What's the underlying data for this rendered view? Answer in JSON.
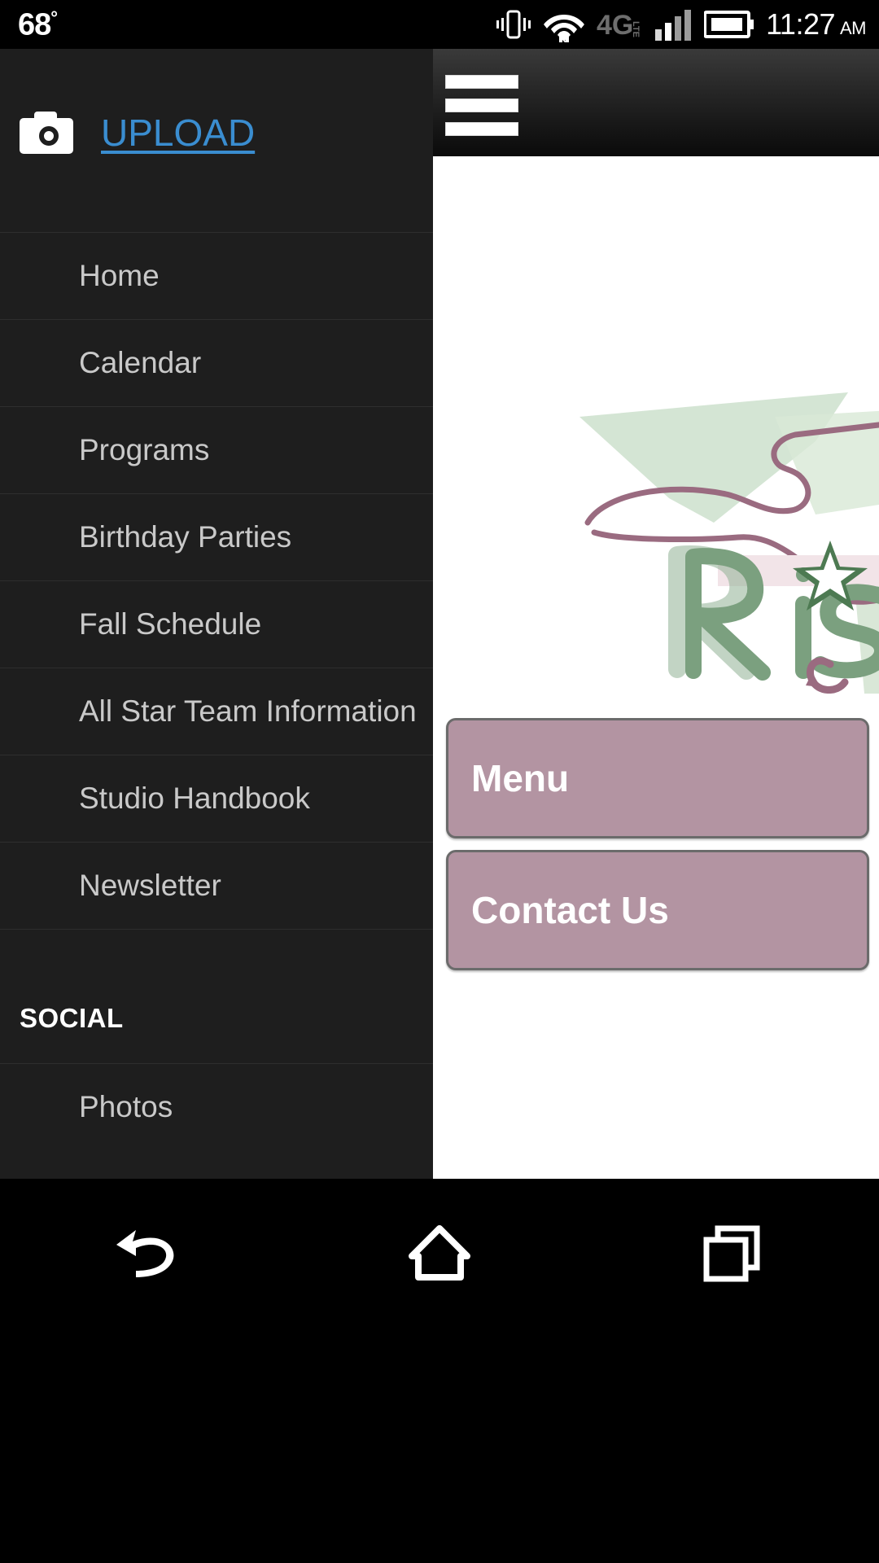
{
  "status_bar": {
    "temperature": "68",
    "degree_symbol": "°",
    "time": "11:27",
    "meridiem": "AM",
    "network": "4G LTE",
    "icons": [
      "vibrate-icon",
      "wifi-icon",
      "4glte-icon",
      "signal-bars-icon",
      "battery-icon"
    ]
  },
  "drawer": {
    "upload": {
      "label": "UPLOAD",
      "icon": "camera-icon",
      "color": "#3a8dd0"
    },
    "nav_items": [
      {
        "label": "Home"
      },
      {
        "label": "Calendar"
      },
      {
        "label": "Programs"
      },
      {
        "label": "Birthday Parties"
      },
      {
        "label": "Fall Schedule"
      },
      {
        "label": "All Star Team Information"
      },
      {
        "label": "Studio Handbook"
      },
      {
        "label": "Newsletter"
      }
    ],
    "social_section": {
      "heading": "SOCIAL",
      "items": [
        {
          "label": "Photos"
        }
      ]
    }
  },
  "content": {
    "header": {
      "menu_icon": "hamburger-icon"
    },
    "logo": {
      "text": "Ris",
      "accent_icons": [
        "star-icon",
        "swirl-icon"
      ],
      "green": "#8fb193",
      "mauve": "#9a6b80",
      "pink": "#f0e2e6"
    },
    "buttons": [
      {
        "label": "Menu",
        "color": "#b394a2"
      },
      {
        "label": "Contact Us",
        "color": "#b394a2"
      }
    ]
  },
  "nav_bar": {
    "buttons": [
      {
        "name": "back",
        "icon": "back-arrow-icon"
      },
      {
        "name": "home",
        "icon": "home-icon"
      },
      {
        "name": "recents",
        "icon": "recents-icon"
      }
    ]
  }
}
